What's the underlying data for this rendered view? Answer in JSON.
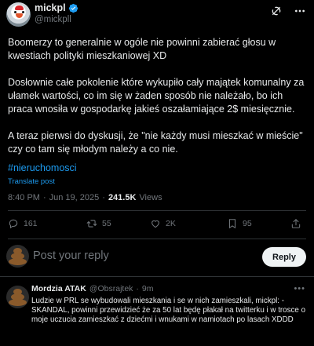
{
  "header": {
    "display_name": "mickpl",
    "handle": "@mickpll",
    "verified": true
  },
  "tweet": {
    "paragraphs": [
      "Boomerzy to generalnie w ogóle nie powinni zabierać głosu w kwestiach polityki mieszkaniowej XD",
      "Dosłownie całe pokolenie które wykupiło cały majątek komunalny za ułamek wartości, co im się w żaden sposób nie należało, bo ich praca wnosiła w gospodarkę jakieś oszałamiające 2$ miesięcznie.",
      "A teraz pierwsi do dyskusji, że \"nie każdy musi mieszkać w mieście\" czy co tam się młodym należy a co nie."
    ],
    "hashtag": "#nieruchomosci",
    "translate_label": "Translate post",
    "time": "8:40 PM",
    "separator": "·",
    "date": "Jun 19, 2025",
    "views_count": "241.5K",
    "views_label": "Views"
  },
  "actions": {
    "replies": "161",
    "reposts": "55",
    "likes": "2K",
    "bookmarks": "95"
  },
  "reply_box": {
    "placeholder": "Post your reply",
    "button_label": "Reply"
  },
  "reply": {
    "name": "Mordzia ATAK",
    "handle": "@Obsrajtek",
    "separator": "·",
    "time": "9m",
    "text": "Ludzie w PRL se wybudowali mieszkania i se w nich zamieszkali, mickpl: -SKANDAL, powinni przewidzieć że za 50 lat będę płakał na twitterku i w trosce o moje uczucia zamieszkać z dziećmi i wnukami w namiotach po lasach XDDD"
  },
  "colors": {
    "background": "#000000",
    "text": "#e7e9ea",
    "muted": "#71767b",
    "accent": "#1d9bf0",
    "divider": "#2f3336"
  },
  "icons": [
    "verified-badge-icon",
    "grok-icon",
    "more-icon",
    "reply-icon",
    "repost-icon",
    "like-icon",
    "bookmark-icon",
    "share-icon"
  ]
}
